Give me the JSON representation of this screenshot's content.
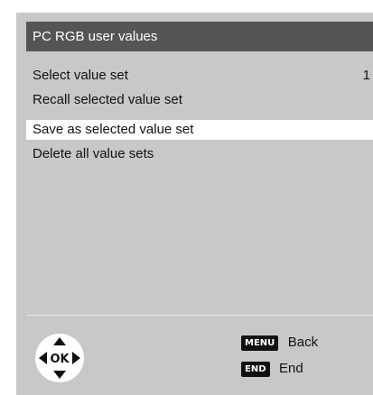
{
  "menu": {
    "title": "PC RGB user values",
    "items": [
      {
        "label": "Select value set",
        "value": "1",
        "selected": false
      },
      {
        "label": "Recall selected value set",
        "value": "",
        "selected": false
      },
      {
        "label": "Save as selected value set",
        "value": "",
        "selected": true
      },
      {
        "label": "Delete all value sets",
        "value": "",
        "selected": false
      }
    ]
  },
  "footer": {
    "ok_label": "OK",
    "keys": [
      {
        "key": "MENU",
        "label": "Back"
      },
      {
        "key": "END",
        "label": "End"
      }
    ]
  },
  "colors": {
    "panel": "#c8c8c8",
    "title_bar": "#555555",
    "highlight": "#ffffff",
    "key_box": "#111111"
  }
}
